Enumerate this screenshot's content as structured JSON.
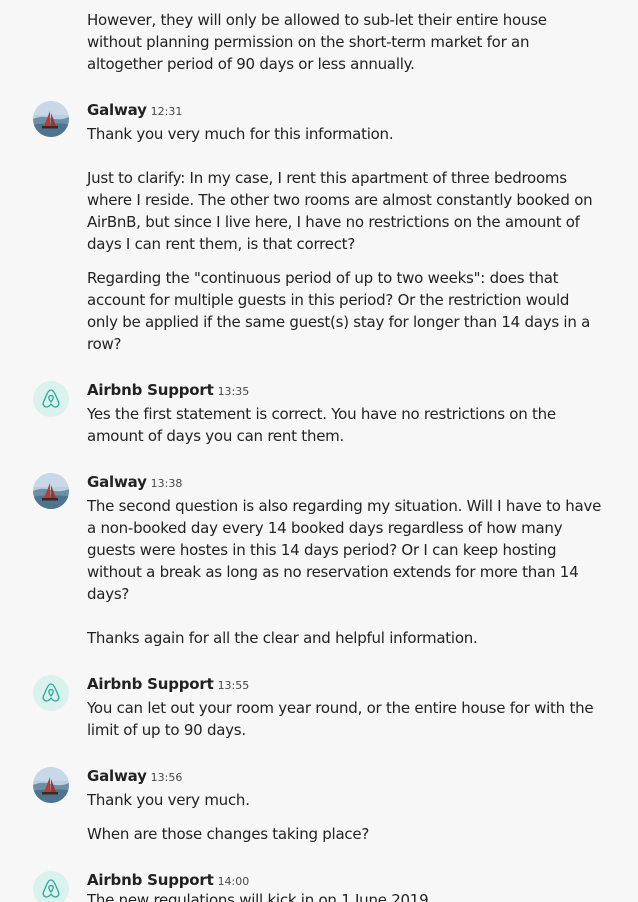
{
  "thread": {
    "intro_lines": [
      "However, they will only be allowed to sub-let their entire house",
      "without planning permission on the short-term market for an",
      "altogether period of 90 days or less annually."
    ],
    "messages": [
      {
        "sender": "Galway",
        "time": "12:31",
        "avatar": "sailboat-photo",
        "lines": [
          "Thank you very much for this information.",
          "",
          "Just to clarify: In my case, I rent this apartment of three bedrooms",
          "where I reside. The other two rooms are almost constantly booked on",
          "AirBnB, but since I live here, I have no restrictions on the amount of",
          "days I can rent them, is that correct?",
          "Regarding the \"continuous period of up to two weeks\": does that",
          "account for multiple guests in this period? Or the restriction would",
          "only be applied if the same guest(s) stay for longer than 14 days in a",
          "row?"
        ]
      },
      {
        "sender": "Airbnb Support",
        "time": "13:35",
        "avatar": "airbnb-logo",
        "lines": [
          "Yes the first statement is correct. You have no restrictions on the",
          "amount of days you can rent them."
        ]
      },
      {
        "sender": "Galway",
        "time": "13:38",
        "avatar": "sailboat-photo",
        "lines": [
          "The second question is also regarding my situation. Will I have to have",
          "a non-booked day every 14 booked days regardless of how many",
          "guests were hostes in this 14 days period? Or I can keep hosting",
          "without a break as long as no reservation extends for more than 14",
          "days?",
          "",
          "Thanks again for all the clear and helpful information."
        ]
      },
      {
        "sender": "Airbnb Support",
        "time": "13:55",
        "avatar": "airbnb-logo",
        "lines": [
          "You can let out your room year round, or the entire house for with the",
          "limit of up to 90 days."
        ]
      },
      {
        "sender": "Galway",
        "time": "13:56",
        "avatar": "sailboat-photo",
        "lines": [
          "Thank you very much.",
          "When are those changes taking place?"
        ]
      },
      {
        "sender": "Airbnb Support",
        "time": "14:00",
        "avatar": "airbnb-logo",
        "lines": [
          "The new regulations will kick in on 1 June 2019"
        ]
      }
    ]
  },
  "colors": {
    "background": "#f7f7f7",
    "text": "#222222",
    "timestamp": "#484848",
    "support_avatar_bg": "#d9f2ee",
    "support_logo": "#2fa59a"
  }
}
